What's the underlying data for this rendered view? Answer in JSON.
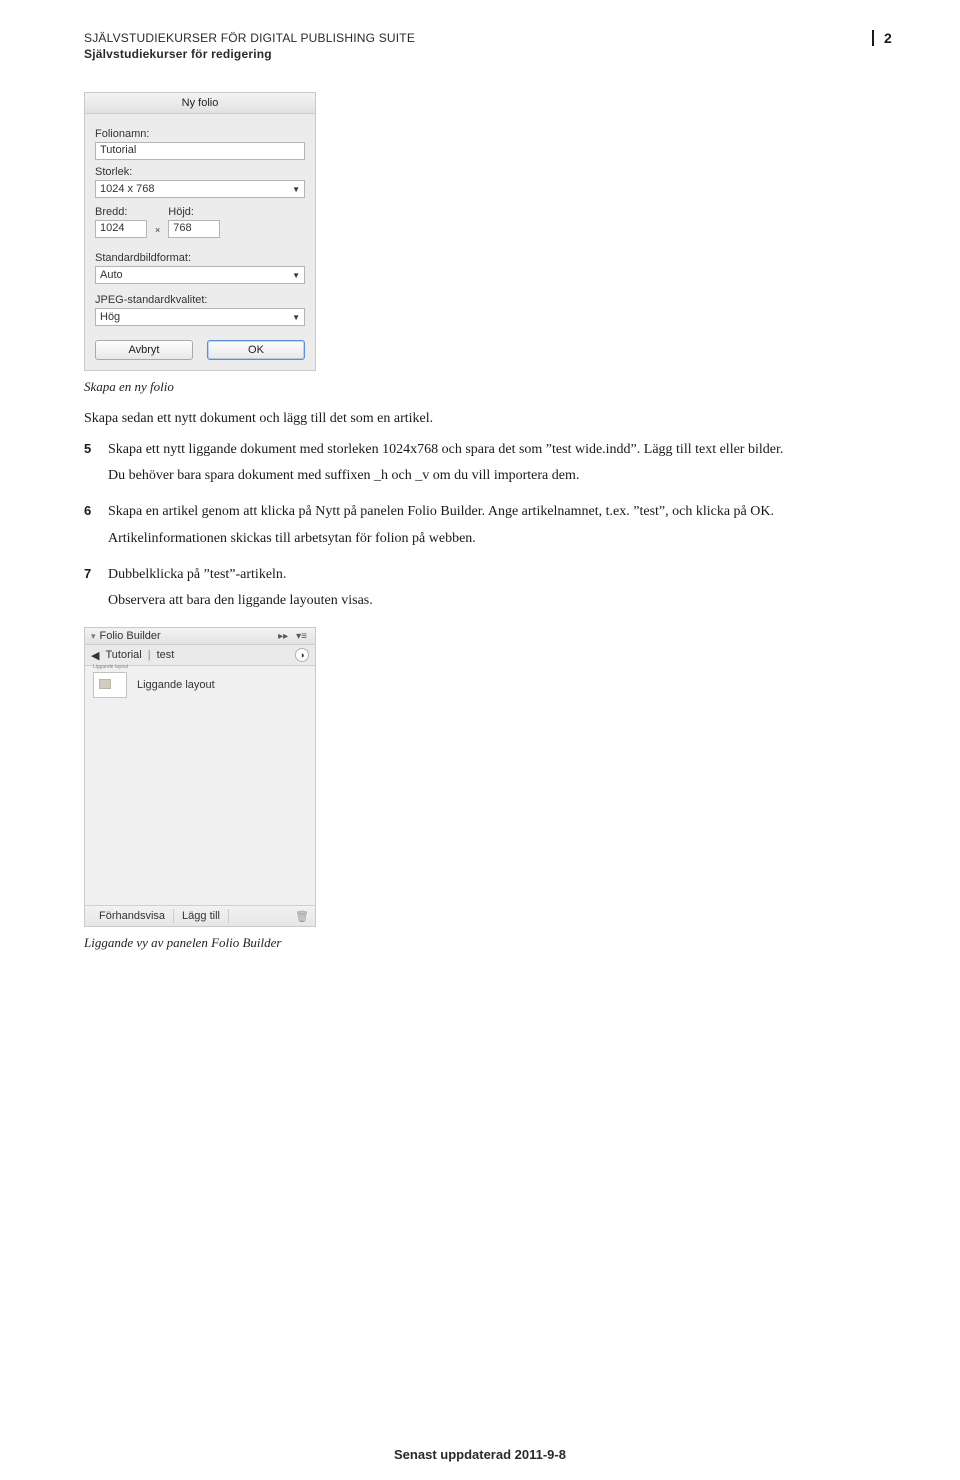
{
  "header": {
    "line1": "SJÄLVSTUDIEKURSER FÖR DIGITAL PUBLISHING SUITE",
    "line2": "Självstudiekurser för redigering",
    "page_number": "2"
  },
  "dialog": {
    "title": "Ny folio",
    "folio_label": "Folionamn:",
    "folio_value": "Tutorial",
    "size_label": "Storlek:",
    "size_value": "1024 x 768",
    "width_label": "Bredd:",
    "width_value": "1024",
    "height_label": "Höjd:",
    "height_value": "768",
    "format_label": "Standardbildformat:",
    "format_value": "Auto",
    "quality_label": "JPEG-standardkvalitet:",
    "quality_value": "Hög",
    "cancel": "Avbryt",
    "ok": "OK"
  },
  "captions": {
    "dialog": "Skapa en ny folio",
    "panel": "Liggande vy av panelen Folio Builder"
  },
  "body": {
    "intro": "Skapa sedan ett nytt dokument och lägg till det som en artikel.",
    "step5_num": "5",
    "step5_p1": "Skapa ett nytt liggande dokument med storleken 1024x768 och spara det som ”test wide.indd”. Lägg till text eller bilder.",
    "step5_p2": "Du behöver bara spara dokument med suffixen _h och _v om du vill importera dem.",
    "step6_num": "6",
    "step6_p1": "Skapa en artikel genom att klicka på Nytt på panelen Folio Builder. Ange artikelnamnet, t.ex. ”test”, och klicka på OK.",
    "step6_p2": "Artikelinformationen skickas till arbetsytan för folion på webben.",
    "step7_num": "7",
    "step7_p1": "Dubbelklicka på ”test”-artikeln.",
    "step7_p2": "Observera att bara den liggande layouten visas."
  },
  "panel": {
    "title": "Folio Builder",
    "crumb1": "Tutorial",
    "crumb2": "test",
    "thumb_label": "Liggande layout",
    "item_label": "Liggande layout",
    "preview": "Förhandsvisa",
    "add": "Lägg till"
  },
  "footer_date": "Senast uppdaterad 2011-9-8"
}
